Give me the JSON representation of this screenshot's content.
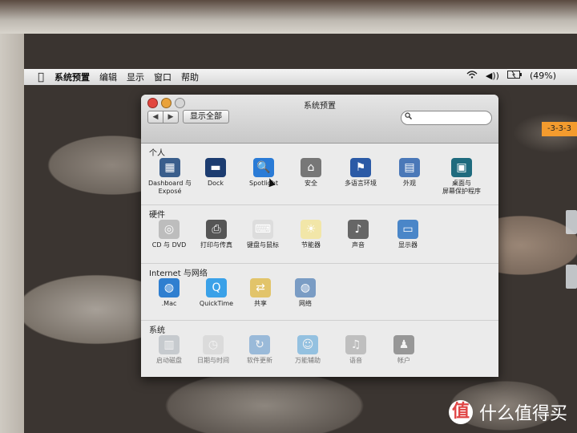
{
  "menubar": {
    "apple_icon": "apple-icon",
    "items": [
      "系统预置",
      "编辑",
      "显示",
      "窗口",
      "帮助"
    ],
    "battery": "(49%)"
  },
  "sticker": "-3-3-3",
  "watermark": {
    "logo": "值",
    "text": "什么值得买"
  },
  "window": {
    "title": "系统预置",
    "show_all": "显示全部",
    "nav_back": "◀",
    "nav_forward": "▶",
    "search_placeholder": ""
  },
  "sections": [
    {
      "title": "个人",
      "items": [
        {
          "label": "Dashboard 与\nExposé",
          "icon": "dashboard-icon",
          "color": "#3a5e8c"
        },
        {
          "label": "Dock",
          "icon": "dock-icon",
          "color": "#1c3c70"
        },
        {
          "label": "Spotlight",
          "icon": "spotlight-icon",
          "color": "#2a7bd6"
        },
        {
          "label": "安全",
          "icon": "security-house-icon",
          "color": "#777777"
        },
        {
          "label": "多语言环境",
          "icon": "flag-icon",
          "color": "#2b5aa6"
        },
        {
          "label": "外观",
          "icon": "appearance-icon",
          "color": "#4a78b8"
        },
        {
          "label": "桌面与\n屏幕保护程序",
          "icon": "desktop-icon",
          "color": "#1f6b7e"
        }
      ]
    },
    {
      "title": "硬件",
      "items": [
        {
          "label": "CD 与 DVD",
          "icon": "cd-icon",
          "color": "#bdbdbd"
        },
        {
          "label": "打印与传真",
          "icon": "printer-icon",
          "color": "#555555"
        },
        {
          "label": "键盘与鼠标",
          "icon": "keyboard-mouse-icon",
          "color": "#dddddd"
        },
        {
          "label": "节能器",
          "icon": "lightbulb-icon",
          "color": "#f2e6a8"
        },
        {
          "label": "声音",
          "icon": "speaker-icon",
          "color": "#666666"
        },
        {
          "label": "显示器",
          "icon": "display-icon",
          "color": "#4a86c8"
        }
      ]
    },
    {
      "title": "Internet 与网络",
      "items": [
        {
          "label": ".Mac",
          "icon": "mac-globe-icon",
          "color": "#2f7fd0"
        },
        {
          "label": "QuickTime",
          "icon": "quicktime-icon",
          "color": "#3aa1e8"
        },
        {
          "label": "共享",
          "icon": "sharing-icon",
          "color": "#e2c46a"
        },
        {
          "label": "网络",
          "icon": "network-globe-icon",
          "color": "#7a9cc4"
        }
      ]
    },
    {
      "title": "系统",
      "items": [
        {
          "label": "启动磁盘",
          "icon": "startup-disk-icon",
          "color": "#9aa3ab"
        },
        {
          "label": "日期与时间",
          "icon": "date-time-icon",
          "color": "#c9c9c9"
        },
        {
          "label": "软件更新",
          "icon": "software-update-icon",
          "color": "#3a7fc4"
        },
        {
          "label": "万能辅助",
          "icon": "universal-access-icon",
          "color": "#2d8fd4"
        },
        {
          "label": "语音",
          "icon": "microphone-icon",
          "color": "#8a8a8a"
        },
        {
          "label": "帐户",
          "icon": "accounts-icon",
          "color": "#333333"
        }
      ]
    }
  ]
}
